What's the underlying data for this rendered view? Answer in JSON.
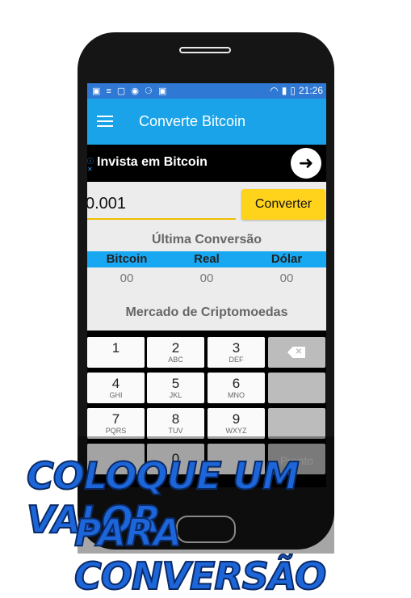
{
  "status_bar": {
    "time": "21:26",
    "left_icons": "▣ ≡ ▢ ◉ ⚆ ▣"
  },
  "app_bar": {
    "title": "Converte Bitcoin"
  },
  "ad": {
    "text": "Invista em Bitcoin",
    "arrow": "➜"
  },
  "converter": {
    "amount": "0.001",
    "button_label": "Converter"
  },
  "last_conversion": {
    "title": "Última Conversão",
    "columns": [
      "Bitcoin",
      "Real",
      "Dólar"
    ],
    "values": [
      "00",
      "00",
      "00"
    ]
  },
  "market": {
    "title": "Mercado de Criptomoedas"
  },
  "keyboard": {
    "keys": [
      {
        "num": "1",
        "sub": ""
      },
      {
        "num": "2",
        "sub": "ABC"
      },
      {
        "num": "3",
        "sub": "DEF"
      },
      {
        "num": "4",
        "sub": "GHI"
      },
      {
        "num": "5",
        "sub": "JKL"
      },
      {
        "num": "6",
        "sub": "MNO"
      },
      {
        "num": "7",
        "sub": "PQRS"
      },
      {
        "num": "8",
        "sub": "TUV"
      },
      {
        "num": "9",
        "sub": "WXYZ"
      },
      {
        "num": "0",
        "sub": ""
      }
    ],
    "done_label": "Pronto"
  },
  "caption": {
    "line1": "COLOQUE UM VALOR",
    "line2": "PARA CONVERSÃO"
  },
  "colors": {
    "accent": "#1aa3e8",
    "status": "#2f78d4",
    "button": "#ffd21c",
    "caption": "#1c66d9"
  }
}
